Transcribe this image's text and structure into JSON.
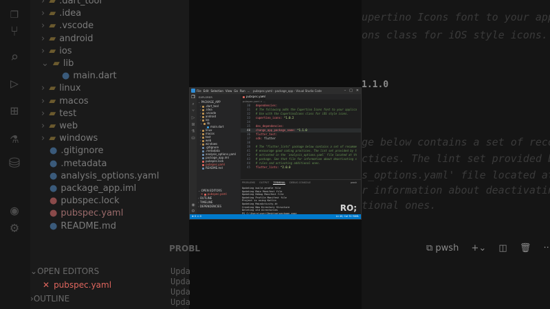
{
  "bg": {
    "tree": [
      {
        "type": "folder",
        "label": ".dart_tool",
        "open": false
      },
      {
        "type": "folder",
        "label": ".idea",
        "open": false
      },
      {
        "type": "folder",
        "label": ".vscode",
        "open": false
      },
      {
        "type": "folder",
        "label": "android",
        "open": false
      },
      {
        "type": "folder",
        "label": "ios",
        "open": false
      },
      {
        "type": "folder",
        "label": "lib",
        "open": true
      },
      {
        "type": "file",
        "label": "main.dart",
        "indent": 1
      },
      {
        "type": "folder",
        "label": "linux",
        "open": false
      },
      {
        "type": "folder",
        "label": "macos",
        "open": false
      },
      {
        "type": "folder",
        "label": "test",
        "open": false
      },
      {
        "type": "folder",
        "label": "web",
        "open": false
      },
      {
        "type": "folder",
        "label": "windows",
        "open": false
      },
      {
        "type": "file",
        "label": ".gitignore"
      },
      {
        "type": "file",
        "label": ".metadata"
      },
      {
        "type": "file",
        "label": "analysis_options.yaml"
      },
      {
        "type": "file",
        "label": "package_app.iml"
      },
      {
        "type": "file",
        "label": "pubspec.lock"
      },
      {
        "type": "file",
        "label": "pubspec.yaml"
      },
      {
        "type": "file",
        "label": "README.md"
      }
    ],
    "open_editors": "OPEN EDITORS",
    "open_file": "pubspec.yaml",
    "outline": "OUTLINE",
    "problems": "PROBL",
    "upda": [
      "Upda",
      "Upda",
      "Upda",
      "Upda",
      "Upda"
    ],
    "right_lines": [
      "upertino Icons font to your applica",
      "ons class for iOS style icons.",
      "1.1.0",
      "ge below contains a set of recomm",
      "ctices. The lint set provided by",
      "s_options.yaml' file located at t",
      "r information about deactivating",
      "tional ones."
    ],
    "term_bar": "pwsh"
  },
  "window": {
    "menu": [
      "File",
      "Edit",
      "Selection",
      "View",
      "Go",
      "Run",
      "..."
    ],
    "title": "pubspec.yaml - package_app - Visual Studio Code",
    "explorer_header": "EXPLORER",
    "project": "PACKAGE_APP",
    "tree": [
      ".dart_tool",
      ".idea",
      ".vscode",
      "android",
      "ios",
      "lib",
      "main.dart",
      "linux",
      "macos",
      "test",
      "web",
      "windows",
      ".gitignore",
      ".metadata",
      "analysis_options.yaml",
      "package_app.iml",
      "pubspec.lock",
      "pubspec.yaml",
      "README.md"
    ],
    "open_editors": "OPEN EDITORS",
    "open_file": "pubspec.yaml",
    "outline": "OUTLINE",
    "timeline": "TIMELINE",
    "dependencies_section": "DEPENDENCIES",
    "tab": "pubspec.yaml",
    "crumb": "pubspec.yaml > ...",
    "code": [
      {
        "n": "30",
        "t": [
          [
            "k",
            "dependencies:"
          ]
        ]
      },
      {
        "n": "31",
        "t": [
          [
            "c",
            "  # The following adds the Cupertino Icons font to your applica"
          ]
        ]
      },
      {
        "n": "32",
        "t": [
          [
            "c",
            "  # Use with the CupertinoIcons class for iOS style icons."
          ]
        ]
      },
      {
        "n": "33",
        "t": [
          [
            "k",
            "  cupertino_icons: "
          ],
          [
            "s",
            "^1.0.2"
          ]
        ]
      },
      {
        "n": "34",
        "t": []
      },
      {
        "n": "35",
        "t": [
          [
            "k",
            "dev_dependencies:"
          ]
        ]
      },
      {
        "n": "40",
        "t": [
          [
            "k",
            "  change_app_package_name: "
          ],
          [
            "s",
            "^1.1.0"
          ]
        ],
        "hl": true
      },
      {
        "n": "36",
        "t": [
          [
            "k",
            "  flutter_test:"
          ]
        ]
      },
      {
        "n": "37",
        "t": [
          [
            "k",
            "    sdk: "
          ],
          [
            "w",
            "flutter"
          ]
        ]
      },
      {
        "n": "38",
        "t": []
      },
      {
        "n": "39",
        "t": [
          [
            "c",
            "  # The \"flutter_lints\" package below contains a set of recomme"
          ]
        ]
      },
      {
        "n": "41",
        "t": [
          [
            "c",
            "  # encourage good coding practices. The lint set provided by t"
          ]
        ]
      },
      {
        "n": "42",
        "t": [
          [
            "c",
            "  # activated in the `analysis_options.yaml` file located at th"
          ]
        ]
      },
      {
        "n": "43",
        "t": [
          [
            "c",
            "  # package. See that file for information about deactivating s"
          ]
        ]
      },
      {
        "n": "44",
        "t": [
          [
            "c",
            "  # rules and activating additional ones."
          ]
        ]
      },
      {
        "n": "45",
        "t": [
          [
            "k",
            "  flutter_lints: "
          ],
          [
            "s",
            "^2.0.0"
          ]
        ]
      }
    ],
    "panel_tabs": [
      "PROBLEMS",
      "OUTPUT",
      "TERMINAL",
      "DEBUG CONSOLE"
    ],
    "active_panel_tab": "TERMINAL",
    "terminal": [
      "Updating build.gradle file",
      "Updating Main Manifest file",
      "Updating Debug Manifest file",
      "Updating Profile Manifest file",
      "Project is using Kotlin",
      "Updating MainActivity.kt",
      "Creating New Directory Structure",
      "Deleting old directories",
      "PS C:\\Users\\user\\Desktop\\package_app> "
    ],
    "overlay": "RO;",
    "pwsh": "pwsh",
    "status_left": "⊗ 0 ⚠ 0",
    "status_right": "Ln 40, Col 31  YAML"
  }
}
